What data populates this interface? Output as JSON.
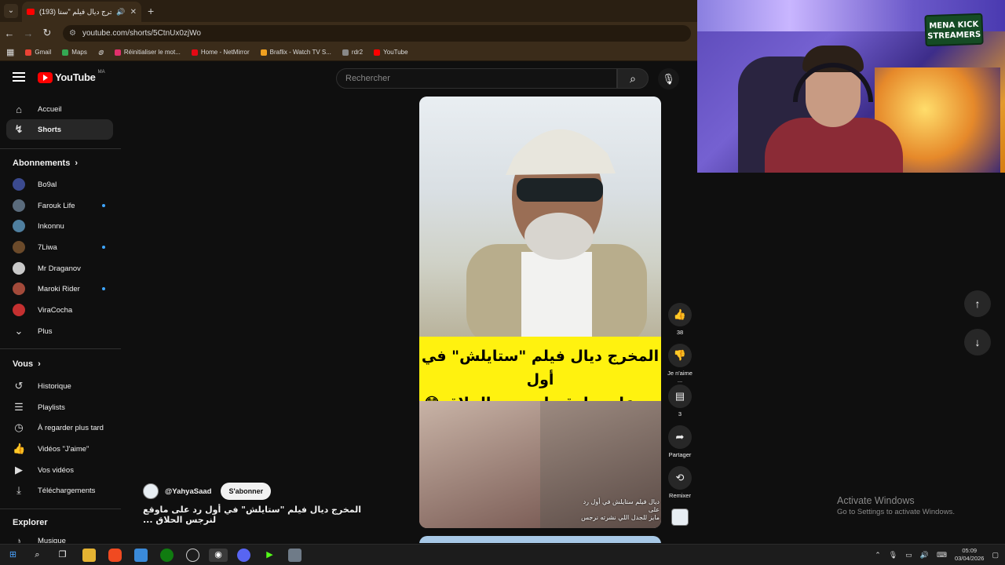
{
  "browser": {
    "tab_title": "(193) المخرج ديال فيلم \"ستا...",
    "url": "youtube.com/shorts/5CtnUx0zjWo",
    "bookmarks": [
      "Gmail",
      "Maps",
      "Réinitialiser le mot...",
      "Home - NetMirror",
      "Braflix - Watch TV S...",
      "rdr2",
      "YouTube"
    ],
    "bookmark_colors": [
      "#ea4335",
      "#34a853",
      "#e1306c",
      "#e50914",
      "#f0a020",
      "#888888",
      "#ff0000"
    ]
  },
  "youtube": {
    "logo_text": "YouTube",
    "country_code": "MA",
    "search_placeholder": "Rechercher",
    "sidebar": {
      "home": "Accueil",
      "shorts": "Shorts",
      "subscriptions_header": "Abonnements",
      "subscriptions": [
        {
          "name": "Bo9al",
          "live": false,
          "color": "#3b4a8f"
        },
        {
          "name": "Farouk Life",
          "live": true,
          "color": "#5a6b7c"
        },
        {
          "name": "Inkonnu",
          "live": false,
          "color": "#4f7f9f"
        },
        {
          "name": "7Liwa",
          "live": true,
          "color": "#6b4a2a"
        },
        {
          "name": "Mr Draganov",
          "live": false,
          "color": "#c9c9c9"
        },
        {
          "name": "Maroki Rider",
          "live": true,
          "color": "#a34a3a"
        },
        {
          "name": "ViraCocha",
          "live": false,
          "color": "#c43030"
        }
      ],
      "more": "Plus",
      "you_header": "Vous",
      "you_items": [
        "Historique",
        "Playlists",
        "À regarder plus tard",
        "Vidéos \"J'aime\"",
        "Vos vidéos",
        "Téléchargements"
      ],
      "explore_header": "Explorer",
      "explore_items": [
        "Musique"
      ]
    },
    "short": {
      "caption_line1": "المخرج ديال فيلم \"ستايلش\" في أول",
      "caption_line2": "رد على ماوقع لنرجس الحلاق 😳🙄",
      "overlay_line1": "ديال فيلم ستايلش في أول رد على",
      "overlay_line2": "مايز للجدل اللي نشرته نرجس",
      "channel": "@YahyaSaad",
      "subscribe": "S'abonner",
      "title": "المخرج ديال فيلم \"ستايلش\" في أول رد على ماوقع لنرجس الحلاق ...",
      "likes": "38",
      "dislike_label": "Je n'aime ...",
      "comments": "3",
      "share_label": "Partager",
      "remix_label": "Remixer"
    }
  },
  "webcam": {
    "badge_line1": "MENA KICK",
    "badge_line2": "STREAMERS"
  },
  "windows": {
    "activate_title": "Activate Windows",
    "activate_sub": "Go to Settings to activate Windows.",
    "time": "05:09",
    "date": "03/04/2026"
  }
}
